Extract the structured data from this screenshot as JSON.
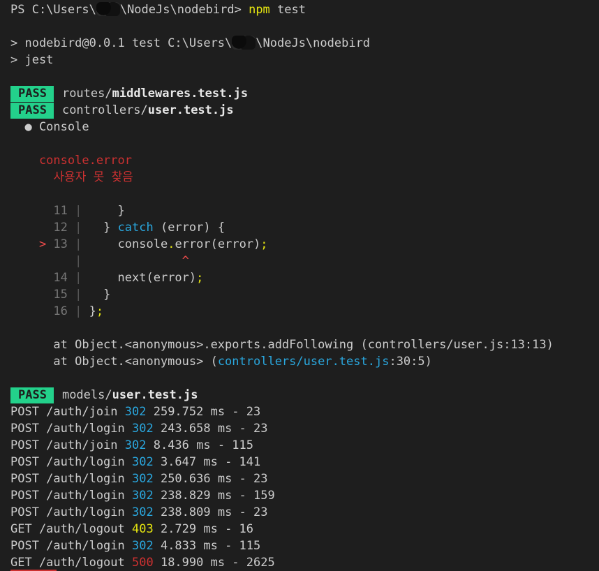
{
  "prompt": {
    "ps_prefix": "PS C:\\Users\\",
    "ps_path_tail": "\\NodeJs\\nodebird>",
    "command": "npm",
    "command_arg": " test"
  },
  "script_header": {
    "line1_prefix": "> nodebird@0.0.1 test C:\\Users\\",
    "line1_tail": "\\NodeJs\\nodebird",
    "line2": "> jest"
  },
  "results": [
    {
      "status": "PASS",
      "dir": "routes/",
      "file": "middlewares.test.js"
    },
    {
      "status": "PASS",
      "dir": "controllers/",
      "file": "user.test.js"
    }
  ],
  "console_section": {
    "heading": "  ● Console",
    "error_label": "    console.error",
    "error_message": "      사용자 못 찾음"
  },
  "code_frame": {
    "l11_num": "      11 ",
    "l11_code": "     }",
    "l12_num": "      12 ",
    "l12_pre": "   } ",
    "l12_kw": "catch",
    "l12_post": " (error) {",
    "l13_marker": "    > ",
    "l13_num": "13 ",
    "l13_code_a": "     console",
    "l13_dot": ".",
    "l13_code_b": "error(error)",
    "l13_semi": ";",
    "caret_pad": "         ",
    "caret_spaces": "              ",
    "caret": "^",
    "l14_num": "      14 ",
    "l14_code": "     next(error)",
    "l14_semi": ";",
    "l15_num": "      15 ",
    "l15_code": "   }",
    "l16_num": "      16 ",
    "l16_code": " }",
    "l16_semi": ";",
    "bar": "|"
  },
  "stack": {
    "line1": "      at Object.<anonymous>.exports.addFollowing (controllers/user.js:13:13)",
    "line2_prefix": "      at Object.<anonymous> (",
    "line2_link": "controllers/user.test.js",
    "line2_suffix": ":30:5)"
  },
  "result3": {
    "status": "PASS",
    "dir": "models/",
    "file": "user.test.js"
  },
  "requests": [
    {
      "method_path": "POST /auth/join ",
      "code": "302",
      "code_color": "#2aa7de",
      "rest": " 259.752 ms - 23"
    },
    {
      "method_path": "POST /auth/login ",
      "code": "302",
      "code_color": "#2aa7de",
      "rest": " 243.658 ms - 23"
    },
    {
      "method_path": "POST /auth/join ",
      "code": "302",
      "code_color": "#2aa7de",
      "rest": " 8.436 ms - 115"
    },
    {
      "method_path": "POST /auth/login ",
      "code": "302",
      "code_color": "#2aa7de",
      "rest": " 3.647 ms - 141"
    },
    {
      "method_path": "POST /auth/login ",
      "code": "302",
      "code_color": "#2aa7de",
      "rest": " 250.636 ms - 23"
    },
    {
      "method_path": "POST /auth/login ",
      "code": "302",
      "code_color": "#2aa7de",
      "rest": " 238.829 ms - 159"
    },
    {
      "method_path": "POST /auth/login ",
      "code": "302",
      "code_color": "#2aa7de",
      "rest": " 238.809 ms - 23"
    },
    {
      "method_path": "GET /auth/logout ",
      "code": "403",
      "code_color": "#e5e510",
      "rest": " 2.729 ms - 16"
    },
    {
      "method_path": "POST /auth/login ",
      "code": "302",
      "code_color": "#2aa7de",
      "rest": " 4.833 ms - 115"
    },
    {
      "method_path": "GET /auth/logout ",
      "code": "500",
      "code_color": "#cd3131",
      "rest": " 18.990 ms - 2625"
    }
  ],
  "colors": {
    "background": "#1e1e1e",
    "pass_badge": "#23d18b",
    "keyword_blue": "#2aa7de",
    "yellow": "#e5e510",
    "red": "#cd3131"
  }
}
